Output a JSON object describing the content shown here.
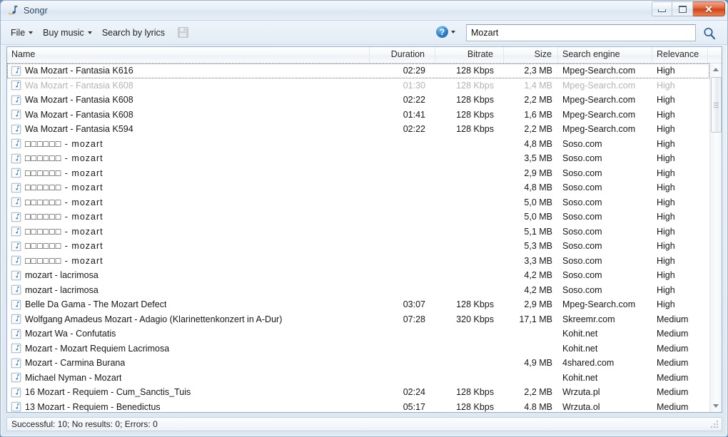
{
  "window": {
    "title": "Songr",
    "icon": "music-note-icon",
    "buttons": {
      "minimize": "minimize-button",
      "maximize": "maximize-button",
      "close": "close-button",
      "close_glyph": "✕"
    }
  },
  "toolbar": {
    "menus": [
      {
        "label": "File",
        "has_caret": true
      },
      {
        "label": "Buy music",
        "has_caret": true
      },
      {
        "label": "Search by lyrics",
        "has_caret": false
      }
    ],
    "save_icon": "save-disk-icon",
    "help_label": "?",
    "help_caret": true
  },
  "search": {
    "value": "Mozart",
    "placeholder": "",
    "go_icon": "magnifier-icon"
  },
  "list": {
    "columns": [
      {
        "key": "name",
        "label": "Name"
      },
      {
        "key": "duration",
        "label": "Duration"
      },
      {
        "key": "bitrate",
        "label": "Bitrate"
      },
      {
        "key": "size",
        "label": "Size"
      },
      {
        "key": "engine",
        "label": "Search engine"
      },
      {
        "key": "relevance",
        "label": "Relevance"
      }
    ],
    "rows": [
      {
        "name": "Wa Mozart - Fantasia K616",
        "duration": "02:29",
        "bitrate": "128 Kbps",
        "size": "2,3 MB",
        "engine": "Mpeg-Search.com",
        "relevance": "High",
        "state": "focused"
      },
      {
        "name": "Wa Mozart - Fantasia K608",
        "duration": "01:30",
        "bitrate": "128 Kbps",
        "size": "1,4 MB",
        "engine": "Mpeg-Search.com",
        "relevance": "High",
        "state": "dimmed"
      },
      {
        "name": "Wa Mozart - Fantasia K608",
        "duration": "02:22",
        "bitrate": "128 Kbps",
        "size": "2,2 MB",
        "engine": "Mpeg-Search.com",
        "relevance": "High",
        "state": ""
      },
      {
        "name": "Wa Mozart - Fantasia K608",
        "duration": "01:41",
        "bitrate": "128 Kbps",
        "size": "1,6 MB",
        "engine": "Mpeg-Search.com",
        "relevance": "High",
        "state": ""
      },
      {
        "name": "Wa Mozart - Fantasia K594",
        "duration": "02:22",
        "bitrate": "128 Kbps",
        "size": "2,2 MB",
        "engine": "Mpeg-Search.com",
        "relevance": "High",
        "state": ""
      },
      {
        "name": "□□□□□□ - mozart",
        "duration": "",
        "bitrate": "",
        "size": "4,8 MB",
        "engine": "Soso.com",
        "relevance": "High",
        "state": "tofu"
      },
      {
        "name": "□□□□□□ - mozart",
        "duration": "",
        "bitrate": "",
        "size": "3,5 MB",
        "engine": "Soso.com",
        "relevance": "High",
        "state": "tofu"
      },
      {
        "name": "□□□□□□ - mozart",
        "duration": "",
        "bitrate": "",
        "size": "2,9 MB",
        "engine": "Soso.com",
        "relevance": "High",
        "state": "tofu"
      },
      {
        "name": "□□□□□□ - mozart",
        "duration": "",
        "bitrate": "",
        "size": "4,8 MB",
        "engine": "Soso.com",
        "relevance": "High",
        "state": "tofu"
      },
      {
        "name": "□□□□□□ - mozart",
        "duration": "",
        "bitrate": "",
        "size": "5,0 MB",
        "engine": "Soso.com",
        "relevance": "High",
        "state": "tofu"
      },
      {
        "name": "□□□□□□ - mozart",
        "duration": "",
        "bitrate": "",
        "size": "5,0 MB",
        "engine": "Soso.com",
        "relevance": "High",
        "state": "tofu"
      },
      {
        "name": "□□□□□□ - mozart",
        "duration": "",
        "bitrate": "",
        "size": "5,1 MB",
        "engine": "Soso.com",
        "relevance": "High",
        "state": "tofu"
      },
      {
        "name": "□□□□□□ - mozart",
        "duration": "",
        "bitrate": "",
        "size": "5,3 MB",
        "engine": "Soso.com",
        "relevance": "High",
        "state": "tofu"
      },
      {
        "name": "□□□□□□ - mozart",
        "duration": "",
        "bitrate": "",
        "size": "3,3 MB",
        "engine": "Soso.com",
        "relevance": "High",
        "state": "tofu"
      },
      {
        "name": "mozart - lacrimosa",
        "duration": "",
        "bitrate": "",
        "size": "4,2 MB",
        "engine": "Soso.com",
        "relevance": "High",
        "state": ""
      },
      {
        "name": "mozart - lacrimosa",
        "duration": "",
        "bitrate": "",
        "size": "4,2 MB",
        "engine": "Soso.com",
        "relevance": "High",
        "state": ""
      },
      {
        "name": "Belle Da Gama - The Mozart Defect",
        "duration": "03:07",
        "bitrate": "128 Kbps",
        "size": "2,9 MB",
        "engine": "Mpeg-Search.com",
        "relevance": "High",
        "state": ""
      },
      {
        "name": "Wolfgang Amadeus Mozart - Adagio (Klarinettenkonzert in A-Dur)",
        "duration": "07:28",
        "bitrate": "320 Kbps",
        "size": "17,1 MB",
        "engine": "Skreemr.com",
        "relevance": "Medium",
        "state": ""
      },
      {
        "name": "Mozart Wa - Confutatis",
        "duration": "",
        "bitrate": "",
        "size": "",
        "engine": "Kohit.net",
        "relevance": "Medium",
        "state": ""
      },
      {
        "name": "Mozart - Mozart Requiem Lacrimosa",
        "duration": "",
        "bitrate": "",
        "size": "",
        "engine": "Kohit.net",
        "relevance": "Medium",
        "state": ""
      },
      {
        "name": "Mozart - Carmina Burana",
        "duration": "",
        "bitrate": "",
        "size": "4,9 MB",
        "engine": "4shared.com",
        "relevance": "Medium",
        "state": ""
      },
      {
        "name": "Michael Nyman - Mozart",
        "duration": "",
        "bitrate": "",
        "size": "",
        "engine": "Kohit.net",
        "relevance": "Medium",
        "state": ""
      },
      {
        "name": "16 Mozart - Requiem - Cum_Sanctis_Tuis",
        "duration": "02:24",
        "bitrate": "128 Kbps",
        "size": "2,2 MB",
        "engine": "Wrzuta.pl",
        "relevance": "Medium",
        "state": ""
      },
      {
        "name": "13 Mozart - Requiem - Benedictus",
        "duration": "05:17",
        "bitrate": "128 Kbps",
        "size": "4.8 MB",
        "engine": "Wrzuta.ol",
        "relevance": "Medium",
        "state": ""
      }
    ],
    "row_icon": "music-note-icon"
  },
  "scrollbar": {
    "up_icon": "scroll-up-arrow-icon",
    "down_icon": "scroll-down-arrow-icon",
    "thumb": "scroll-thumb"
  },
  "status": {
    "text": "Successful: 10; No results: 0; Errors: 0",
    "grip": "resize-grip-icon"
  },
  "colors": {
    "accent": "#2f7fc4",
    "close_button": "#cf4417",
    "title_text": "#27405c",
    "dimmed_row": "#b3b3b3"
  }
}
